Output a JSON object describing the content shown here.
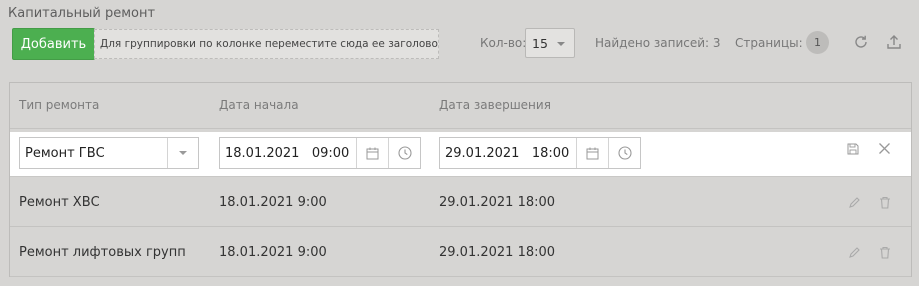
{
  "page": {
    "title": "Капитальный ремонт"
  },
  "toolbar": {
    "add_label": "Добавить",
    "group_hint": "Для группировки по колонке переместите сюда ее заголовок",
    "count_label": "Кол-во:",
    "count_value": "15",
    "found_label": "Найдено записей: 3",
    "pages_label": "Страницы:",
    "page_current": "1",
    "refresh_icon": "refresh-icon",
    "export_icon": "upload-icon"
  },
  "grid": {
    "headers": [
      "Тип ремонта",
      "Дата начала",
      "Дата завершения"
    ],
    "edit_row": {
      "type_value": "Ремонт ГВС",
      "start_value": "18.01.2021   09:00",
      "end_value": "29.01.2021   18:00"
    },
    "rows": [
      {
        "type": "Ремонт ХВС",
        "start": "18.01.2021 9:00",
        "end": "29.01.2021 18:00"
      },
      {
        "type": "Ремонт лифтовых групп",
        "start": "18.01.2021 9:00",
        "end": "29.01.2021 18:00"
      }
    ]
  },
  "colors": {
    "accent": "#4caf50",
    "background": "#d6d5d3"
  }
}
